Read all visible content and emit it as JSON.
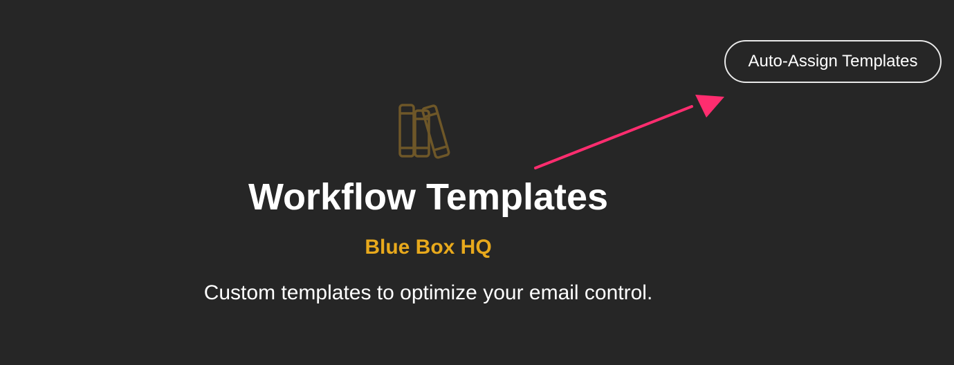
{
  "header": {
    "auto_assign_label": "Auto-Assign Templates"
  },
  "hero": {
    "icon": "books-icon",
    "title": "Workflow Templates",
    "organization": "Blue Box HQ",
    "description": "Custom templates to optimize your email control."
  },
  "annotation": {
    "icon": "arrow-icon",
    "color": "#ff2d6f"
  },
  "colors": {
    "background": "#262626",
    "accent": "#e8a91c",
    "icon": "#6e5728"
  }
}
